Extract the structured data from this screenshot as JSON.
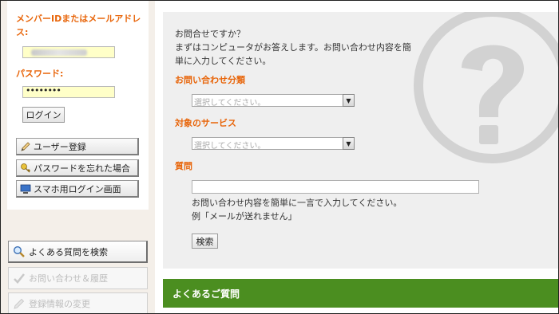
{
  "login": {
    "member_label": "メンバーIDまたはメールアドレス:",
    "password_label": "パスワード:",
    "password_mask": "••••••••",
    "login_button": "ログイン"
  },
  "side_buttons": [
    {
      "label": "ユーザー登録",
      "icon": "pencil-icon"
    },
    {
      "label": "パスワードを忘れた場合",
      "icon": "key-icon"
    },
    {
      "label": "スマホ用ログイン画面",
      "icon": "monitor-icon"
    }
  ],
  "nav": [
    {
      "label": "よくある質問を検索",
      "icon": "magnifier-icon",
      "state": "active"
    },
    {
      "label": "お問い合わせ＆履歴",
      "icon": "checkmark-icon",
      "state": "disabled"
    },
    {
      "label": "登録情報の変更",
      "icon": "pencil-icon",
      "state": "disabled"
    }
  ],
  "inquiry": {
    "intro_line1": "お問合せですか？",
    "intro_line2": "まずはコンピュータがお答えします。お問い合わせ内容を簡",
    "intro_line3": "単に入力してください。",
    "category_label": "お問い合わせ分類",
    "category_placeholder": "選択してください。",
    "service_label": "対象のサービス",
    "service_placeholder": "選択してください。",
    "question_label": "質問",
    "question_value": "",
    "hint_line1": "お問い合わせ内容を簡単に一言で入力してください。",
    "hint_line2": "例「メールが送れません」",
    "search_button": "検索"
  },
  "faq_heading": "よくあるご質問",
  "colors": {
    "accent_orange": "#e8650a",
    "faq_green": "#4b8e20",
    "input_yellow": "#ffffc8",
    "panel_gray": "#efefef"
  }
}
